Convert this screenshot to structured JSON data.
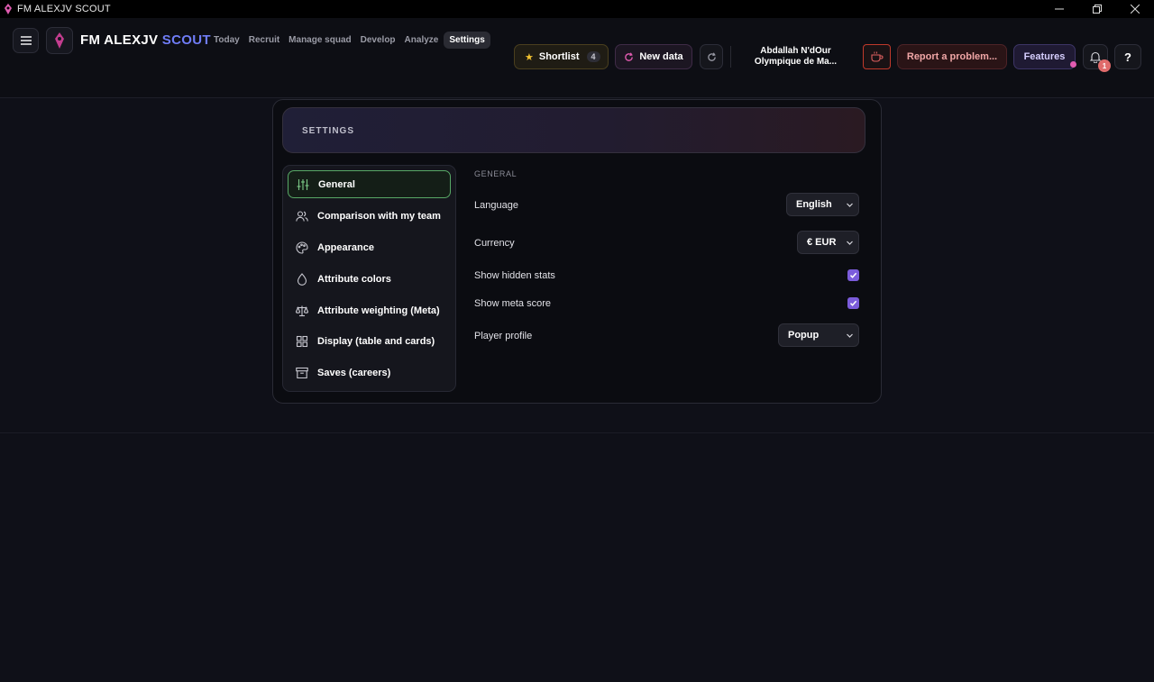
{
  "window": {
    "title": "FM ALEXJV SCOUT"
  },
  "brand": {
    "part1": "FM ALEXJV",
    "part2": "SCOUT"
  },
  "nav": [
    {
      "label": "Today",
      "active": false
    },
    {
      "label": "Recruit",
      "active": false
    },
    {
      "label": "Manage squad",
      "active": false
    },
    {
      "label": "Develop",
      "active": false
    },
    {
      "label": "Analyze",
      "active": false
    },
    {
      "label": "Settings",
      "active": true
    }
  ],
  "toolbar": {
    "shortlist_label": "Shortlist",
    "shortlist_count": "4",
    "new_data_label": "New data",
    "player_name": "Abdallah N'dOur",
    "player_club": "Olympique de Ma...",
    "report_label": "Report a problem...",
    "features_label": "Features",
    "notification_count": "1",
    "help_label": "?"
  },
  "settings": {
    "title": "SETTINGS",
    "menu": [
      {
        "label": "General",
        "icon": "sliders-icon",
        "active": true
      },
      {
        "label": "Comparison with my team",
        "icon": "users-icon",
        "active": false
      },
      {
        "label": "Appearance",
        "icon": "palette-icon",
        "active": false
      },
      {
        "label": "Attribute colors",
        "icon": "droplet-icon",
        "active": false
      },
      {
        "label": "Attribute weighting (Meta)",
        "icon": "scale-icon",
        "active": false
      },
      {
        "label": "Display (table and cards)",
        "icon": "grid-icon",
        "active": false
      },
      {
        "label": "Saves (careers)",
        "icon": "archive-icon",
        "active": false
      }
    ],
    "general": {
      "section_label": "GENERAL",
      "language_label": "Language",
      "language_value": "English",
      "currency_label": "Currency",
      "currency_value": "€ EUR",
      "show_hidden_stats_label": "Show hidden stats",
      "show_hidden_stats_checked": true,
      "show_meta_score_label": "Show meta score",
      "show_meta_score_checked": true,
      "player_profile_label": "Player profile",
      "player_profile_value": "Popup"
    }
  },
  "colors": {
    "accent_purple": "#7b5cdb",
    "brand_blue": "#6f7cf6",
    "active_green": "#58a866",
    "logo_pink": "#e05bb0",
    "danger_red": "#c0392b"
  }
}
